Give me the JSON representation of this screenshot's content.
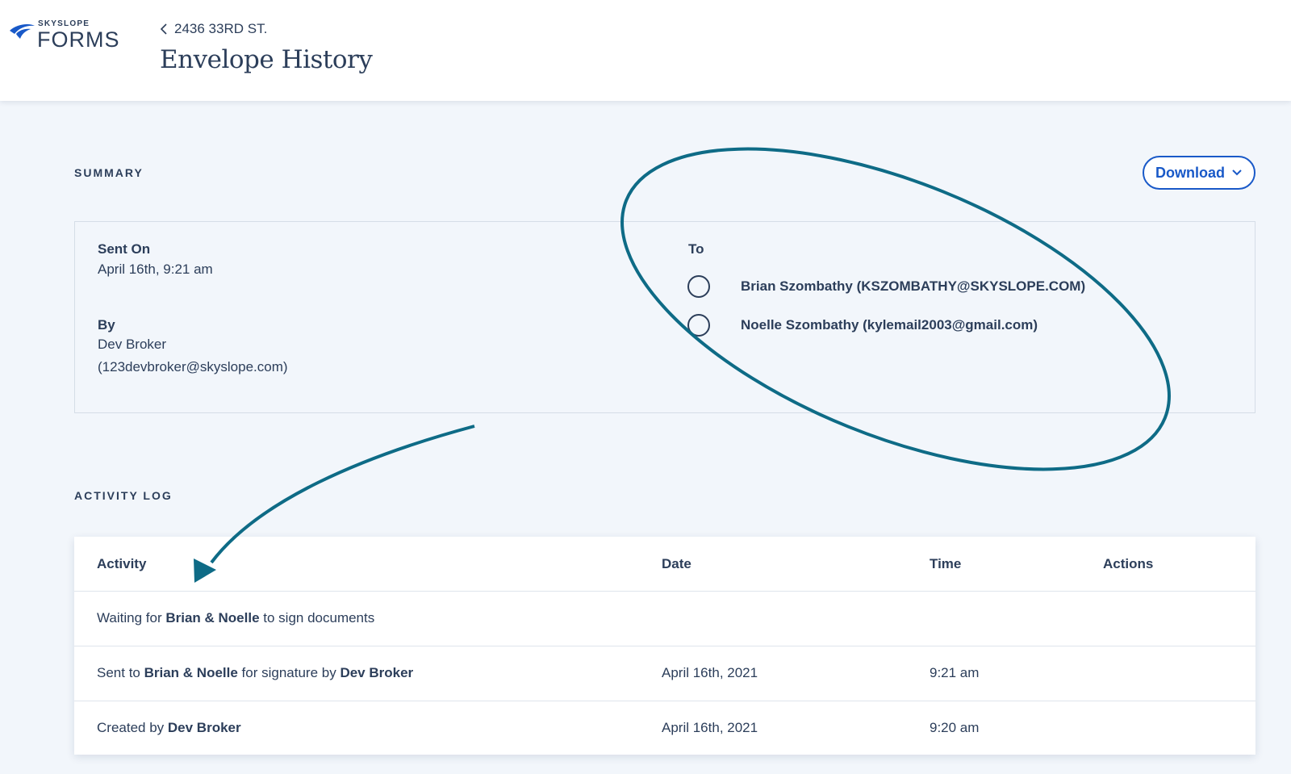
{
  "brand": {
    "small": "SKYSLOPE",
    "big": "FORMS",
    "color": "#1959c8"
  },
  "breadcrumb": {
    "icon": "chevron-left-icon",
    "label": "2436 33RD ST."
  },
  "page_title": "Envelope History",
  "summary": {
    "section_label": "SUMMARY",
    "download_label": "Download",
    "sent_on_label": "Sent On",
    "sent_on_value": "April 16th, 9:21 am",
    "by_label": "By",
    "by_name": "Dev Broker",
    "by_email": "(123devbroker@skyslope.com)",
    "to_label": "To",
    "recipients": [
      "Brian Szombathy (KSZOMBATHY@SKYSLOPE.COM)",
      "Noelle Szombathy (kylemail2003@gmail.com)"
    ]
  },
  "activity_log": {
    "section_label": "ACTIVITY LOG",
    "headers": {
      "activity": "Activity",
      "date": "Date",
      "time": "Time",
      "actions": "Actions"
    },
    "rows": [
      {
        "activity": [
          {
            "text": "Waiting for ",
            "bold": false
          },
          {
            "text": "Brian & Noelle",
            "bold": true
          },
          {
            "text": " to sign documents",
            "bold": false
          }
        ],
        "date": "",
        "time": ""
      },
      {
        "activity": [
          {
            "text": "Sent to ",
            "bold": false
          },
          {
            "text": "Brian & Noelle",
            "bold": true
          },
          {
            "text": " for signature by ",
            "bold": false
          },
          {
            "text": "Dev Broker",
            "bold": true
          }
        ],
        "date": "April 16th, 2021",
        "time": "9:21 am"
      },
      {
        "activity": [
          {
            "text": "Created by ",
            "bold": false
          },
          {
            "text": "Dev Broker",
            "bold": true
          }
        ],
        "date": "April 16th, 2021",
        "time": "9:20 am"
      }
    ]
  },
  "colors": {
    "text": "#2c3e5a",
    "accent": "#1959c8",
    "annotation": "#0e6b86",
    "background": "#f2f6fb"
  }
}
